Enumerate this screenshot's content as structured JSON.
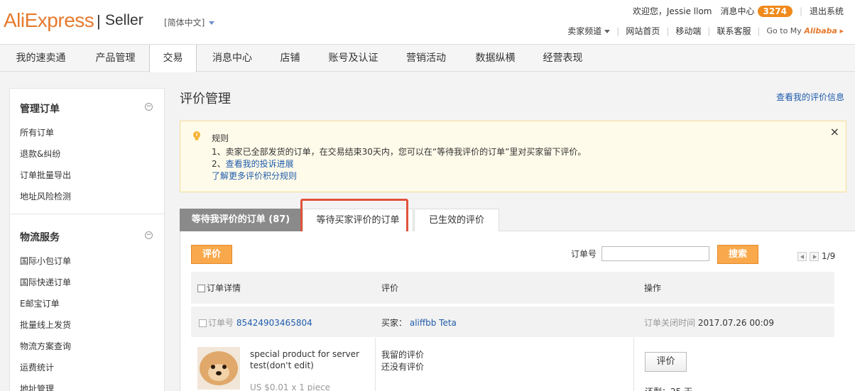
{
  "header": {
    "logo": "AliExpress",
    "logo_sep": "|",
    "logo_suffix": "Seller",
    "language": "[简体中文]",
    "welcome": "欢迎您，Jessie llom",
    "msg_center": "消息中心",
    "msg_count": "3274",
    "logout": "退出系统",
    "seller_channel": "卖家频道",
    "site_home": "网站首页",
    "mobile": "移动端",
    "contact": "联系客服",
    "goto_prefix": "Go to My",
    "goto_brand": "Alibaba",
    "goto_arrow": "▸"
  },
  "nav": {
    "items": [
      "我的速卖通",
      "产品管理",
      "交易",
      "消息中心",
      "店铺",
      "账号及认证",
      "营销活动",
      "数据纵横",
      "经营表现"
    ],
    "active_index": 2
  },
  "sidebar": {
    "groups": [
      {
        "title": "管理订单",
        "toggle": "−",
        "items": [
          "所有订单",
          "退款&纠纷",
          "订单批量导出",
          "地址风险检测"
        ]
      },
      {
        "title": "物流服务",
        "toggle": "−",
        "items": [
          "国际小包订单",
          "国际快递订单",
          "E邮宝订单",
          "批量线上发货",
          "物流方案查询",
          "运费统计",
          "地址管理"
        ]
      }
    ]
  },
  "main": {
    "title": "评价管理",
    "view_my_reviews": "查看我的评价信息",
    "notice": {
      "title": "规则",
      "line1": "1、卖家已全部发货的订单，在交易结束30天内，您可以在“等待我评价的订单”里对买家留下评价。",
      "line2_prefix": "2、",
      "line2_link": "查看我的投诉进展",
      "line3_link": "了解更多评价积分规则",
      "close": "×"
    },
    "tabs": [
      "等待我评价的订单 (87)",
      "等待买家评价的订单",
      "已生效的评价"
    ],
    "actions": {
      "review_button": "评价",
      "order_no_label": "订单号",
      "order_no_value": "",
      "search_button": "搜索",
      "pager": "1/9"
    },
    "table": {
      "headers": [
        "订单详情",
        "评价",
        "操作"
      ],
      "rows": [
        {
          "order_label": "订单号",
          "order_no": "85424903465804",
          "buyer_label": "买家：",
          "buyer_name": "aliffbb Teta",
          "closed_label": "订单关闭时间",
          "closed_time": "2017.07.26 00:09",
          "product_title": "special product for server test(don't edit)",
          "product_price": "US $0.01 x 1 piece",
          "my_review_label": "我留的评价",
          "my_review_value": "还没有评价",
          "action_button": "评价",
          "remaining": "还剩：25 天"
        }
      ]
    }
  },
  "colors": {
    "brand_orange": "#e67a2e",
    "button_orange": "#f9a84b",
    "link_blue": "#1f5bab",
    "highlight_red": "#e0533c",
    "notice_bg": "#fffbea"
  }
}
